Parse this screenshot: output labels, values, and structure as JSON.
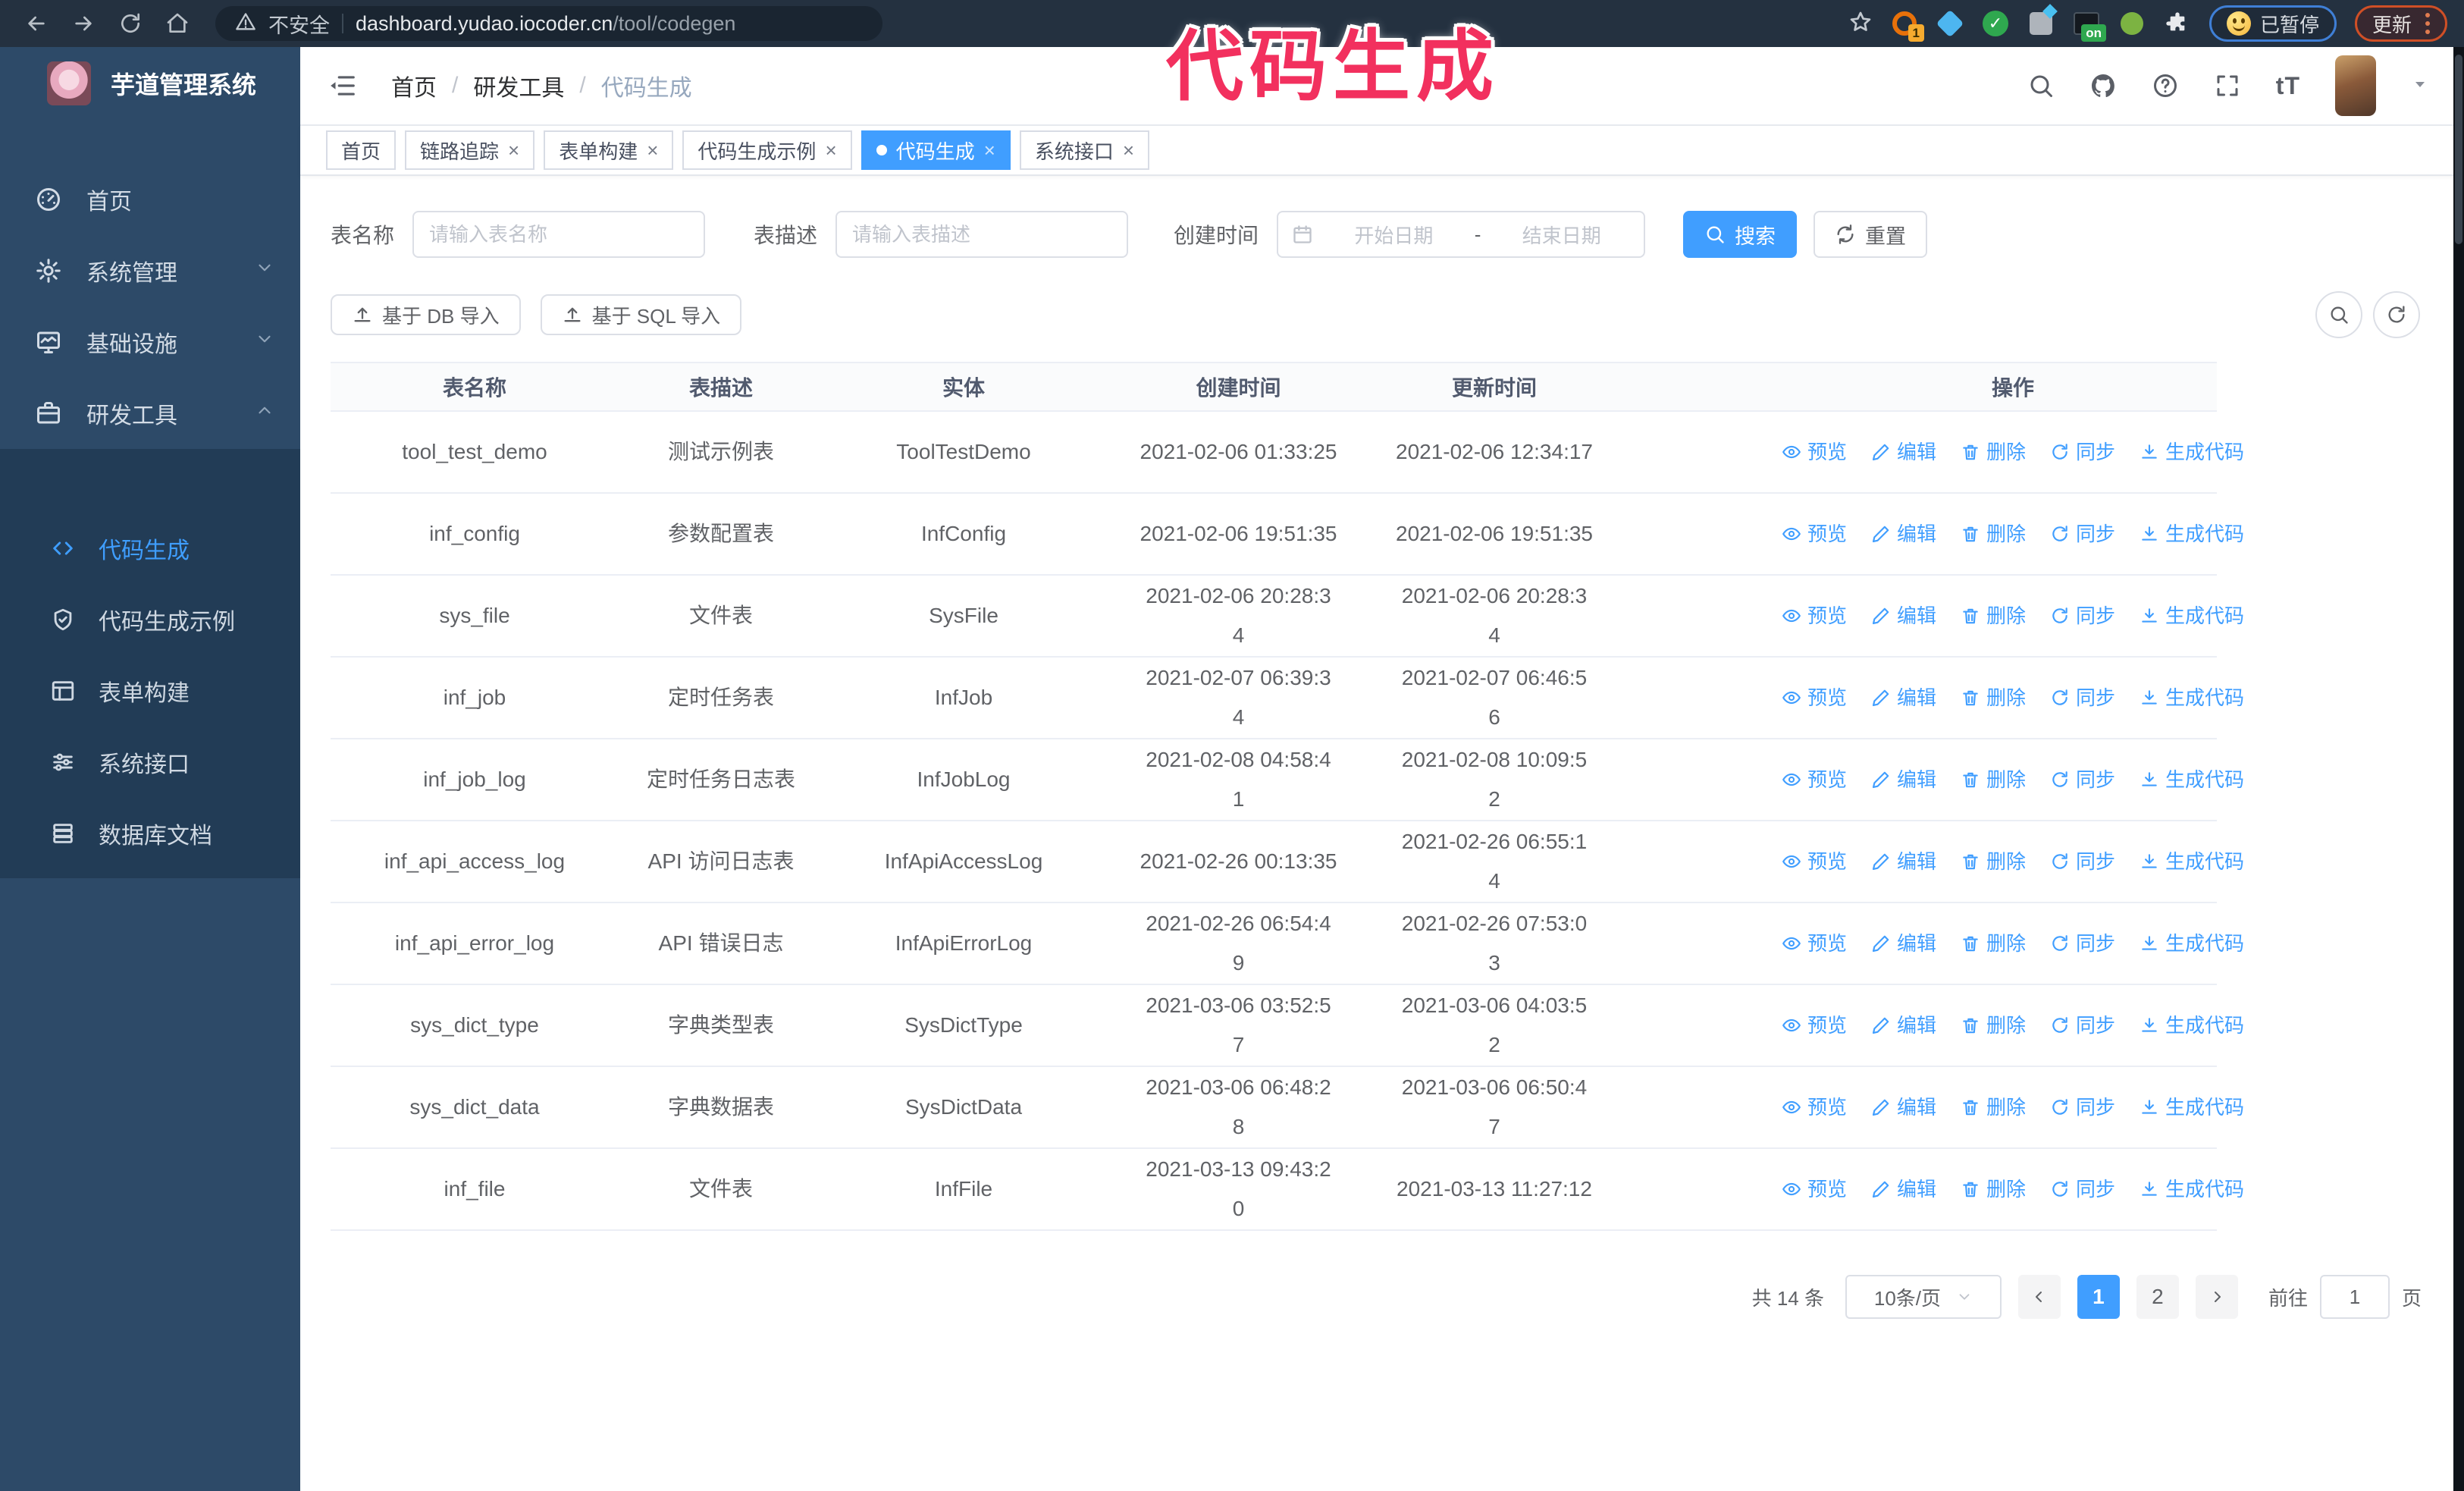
{
  "browser": {
    "security_label": "不安全",
    "url_domain": "dashboard.yudao.iocoder.cn",
    "url_path": "/tool/codegen",
    "ext_badge_count": "1",
    "ext_badge_on": "on",
    "paused_label": "已暂停",
    "update_label": "更新"
  },
  "overlay": {
    "title": "代码生成"
  },
  "sidebar": {
    "logo_title": "芋道管理系统",
    "items": [
      {
        "label": "首页"
      },
      {
        "label": "系统管理"
      },
      {
        "label": "基础设施"
      },
      {
        "label": "研发工具"
      }
    ],
    "submenu": [
      {
        "label": "代码生成"
      },
      {
        "label": "代码生成示例"
      },
      {
        "label": "表单构建"
      },
      {
        "label": "系统接口"
      },
      {
        "label": "数据库文档"
      }
    ]
  },
  "header": {
    "breadcrumb": {
      "home": "首页",
      "section": "研发工具",
      "current": "代码生成"
    }
  },
  "tabs": [
    {
      "label": "首页"
    },
    {
      "label": "链路追踪"
    },
    {
      "label": "表单构建"
    },
    {
      "label": "代码生成示例"
    },
    {
      "label": "代码生成"
    },
    {
      "label": "系统接口"
    }
  ],
  "filter": {
    "name_label": "表名称",
    "name_placeholder": "请输入表名称",
    "desc_label": "表描述",
    "desc_placeholder": "请输入表描述",
    "time_label": "创建时间",
    "start_placeholder": "开始日期",
    "range_separator": "-",
    "end_placeholder": "结束日期",
    "search_label": "搜索",
    "reset_label": "重置"
  },
  "toolbar": {
    "db_import_label": "基于 DB 导入",
    "sql_import_label": "基于 SQL 导入"
  },
  "table": {
    "columns": [
      "表名称",
      "表描述",
      "实体",
      "创建时间",
      "更新时间",
      "操作"
    ],
    "actions": [
      "预览",
      "编辑",
      "删除",
      "同步",
      "生成代码"
    ],
    "rows": [
      {
        "name": "tool_test_demo",
        "desc": "测试示例表",
        "entity": "ToolTestDemo",
        "created": "2021-02-06 01:33:25",
        "updated": "2021-02-06 12:34:17"
      },
      {
        "name": "inf_config",
        "desc": "参数配置表",
        "entity": "InfConfig",
        "created": "2021-02-06 19:51:35",
        "updated": "2021-02-06 19:51:35"
      },
      {
        "name": "sys_file",
        "desc": "文件表",
        "entity": "SysFile",
        "created": "2021-02-06 20:28:3\n4",
        "updated": "2021-02-06 20:28:3\n4"
      },
      {
        "name": "inf_job",
        "desc": "定时任务表",
        "entity": "InfJob",
        "created": "2021-02-07 06:39:3\n4",
        "updated": "2021-02-07 06:46:5\n6"
      },
      {
        "name": "inf_job_log",
        "desc": "定时任务日志表",
        "entity": "InfJobLog",
        "created": "2021-02-08 04:58:4\n1",
        "updated": "2021-02-08 10:09:5\n2"
      },
      {
        "name": "inf_api_access_log",
        "desc": "API 访问日志表",
        "entity": "InfApiAccessLog",
        "created": "2021-02-26 00:13:35",
        "updated": "2021-02-26 06:55:1\n4"
      },
      {
        "name": "inf_api_error_log",
        "desc": "API 错误日志",
        "entity": "InfApiErrorLog",
        "created": "2021-02-26 06:54:4\n9",
        "updated": "2021-02-26 07:53:0\n3"
      },
      {
        "name": "sys_dict_type",
        "desc": "字典类型表",
        "entity": "SysDictType",
        "created": "2021-03-06 03:52:5\n7",
        "updated": "2021-03-06 04:03:5\n2"
      },
      {
        "name": "sys_dict_data",
        "desc": "字典数据表",
        "entity": "SysDictData",
        "created": "2021-03-06 06:48:2\n8",
        "updated": "2021-03-06 06:50:4\n7"
      },
      {
        "name": "inf_file",
        "desc": "文件表",
        "entity": "InfFile",
        "created": "2021-03-13 09:43:2\n0",
        "updated": "2021-03-13 11:27:12"
      }
    ]
  },
  "pagination": {
    "total": "共 14 条",
    "page_size": "10条/页",
    "page_1": "1",
    "page_2": "2",
    "goto_label": "前往",
    "goto_value": "1",
    "goto_unit": "页"
  },
  "colors": {
    "accent": "#409eff",
    "sidebar_bg": "#2d4a68",
    "submenu_bg": "#223c56",
    "overlay_pink": "#f2305e"
  }
}
